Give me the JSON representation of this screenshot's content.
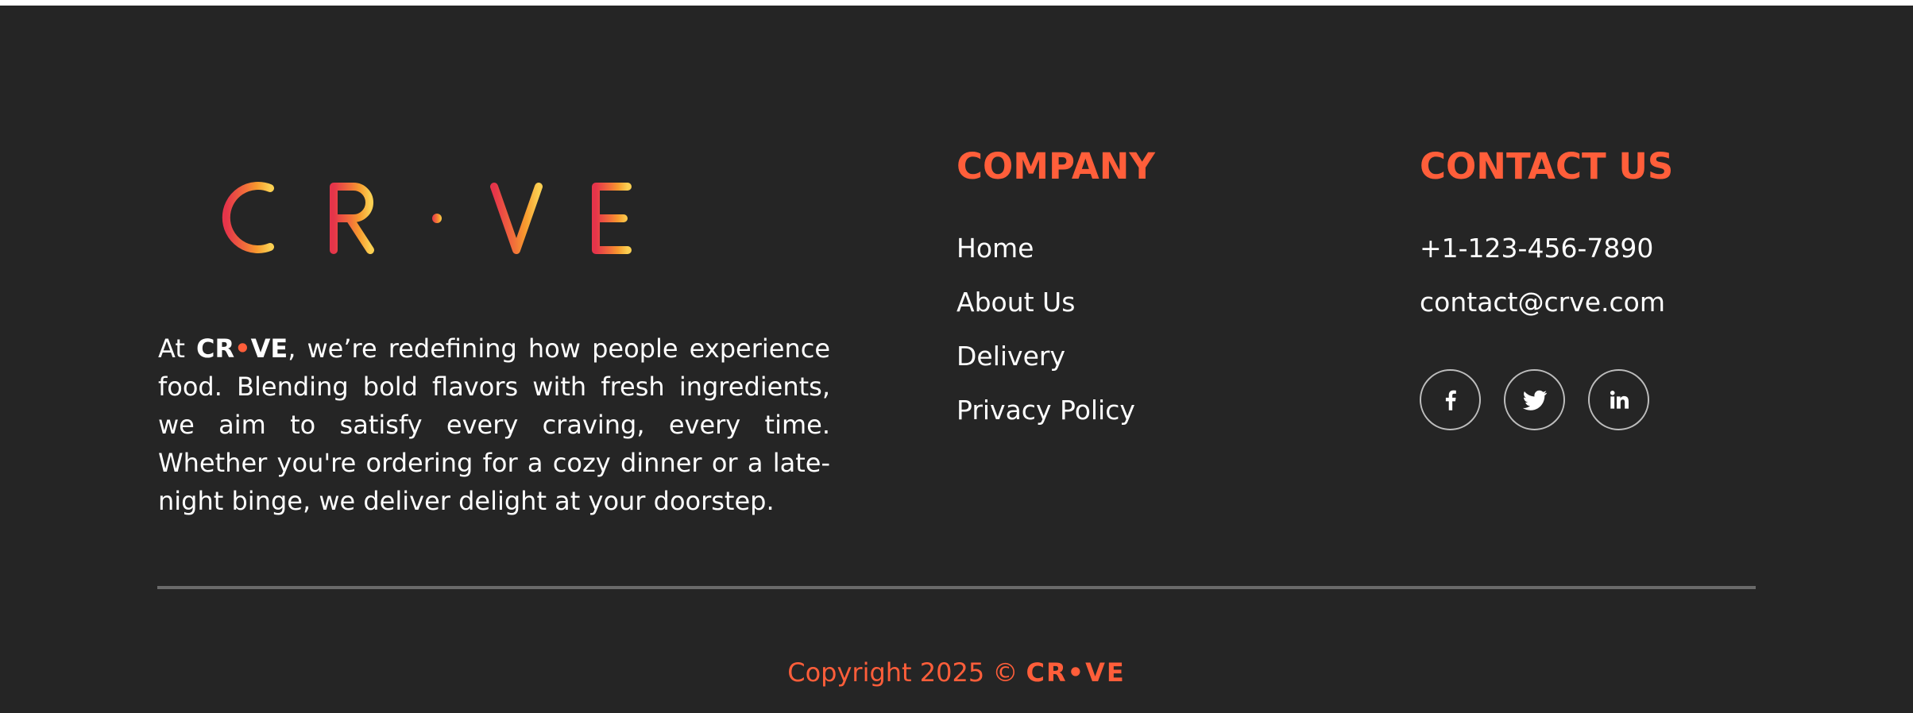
{
  "brand": {
    "name_part1": "CR",
    "name_dot": "•",
    "name_part2": "VE",
    "logo_letters": [
      "C",
      "R",
      "·",
      "V",
      "E"
    ],
    "gradient": [
      "#e5344a",
      "#f2703a",
      "#f79a2e",
      "#fbcf52"
    ]
  },
  "about": {
    "prefix": "At ",
    "suffix": ", we’re redefining how people experience food. Blending bold flavors with fresh ingredients, we aim to satisfy every craving, every time. Whether you're ordering for a cozy dinner or a late-night binge, we deliver delight at your doorstep."
  },
  "company": {
    "title": "COMPANY",
    "links": [
      "Home",
      "About Us",
      "Delivery",
      "Privacy Policy"
    ]
  },
  "contact": {
    "title": "CONTACT US",
    "phone": "+1-123-456-7890",
    "email": "contact@crve.com",
    "socials": [
      "facebook-icon",
      "twitter-icon",
      "linkedin-icon"
    ]
  },
  "copyright": {
    "text": "Copyright 2025 © "
  },
  "colors": {
    "background": "#252525",
    "accent": "#ff5e3a",
    "text": "#ffffff",
    "divider": "#6a6a6a"
  }
}
